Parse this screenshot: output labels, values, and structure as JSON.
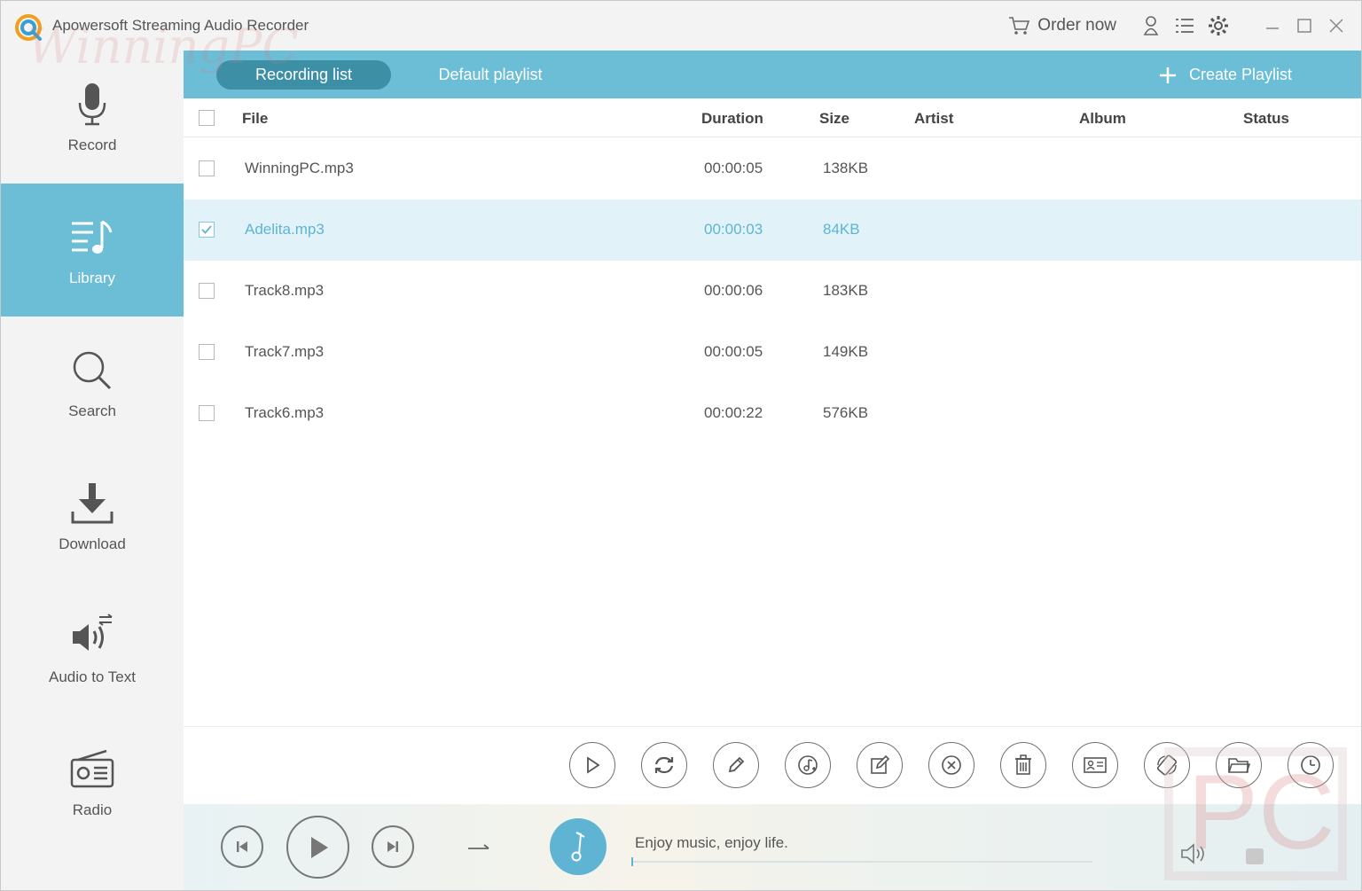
{
  "app": {
    "title": "Apowersoft Streaming Audio Recorder",
    "brand_color": "#6cbdd6",
    "accent_dark": "#3d8fa6",
    "order_label": "Order now",
    "icons": [
      "cart-icon",
      "user-icon",
      "menu-list-icon",
      "gear-icon",
      "minimize-icon",
      "maximize-icon",
      "close-icon"
    ]
  },
  "watermark": {
    "text": "WinningPC",
    "box_text": "PC"
  },
  "sidebar": {
    "items": [
      {
        "label": "Record",
        "icon": "microphone-icon",
        "active": false
      },
      {
        "label": "Library",
        "icon": "music-library-icon",
        "active": true
      },
      {
        "label": "Search",
        "icon": "search-icon",
        "active": false
      },
      {
        "label": "Download",
        "icon": "download-icon",
        "active": false
      },
      {
        "label": "Audio to Text",
        "icon": "audio-to-text-icon",
        "active": false
      },
      {
        "label": "Radio",
        "icon": "radio-icon",
        "active": false
      }
    ]
  },
  "tabs": {
    "recording_list": "Recording list",
    "default_playlist": "Default playlist",
    "create_playlist": "Create Playlist"
  },
  "table": {
    "headers": {
      "file": "File",
      "duration": "Duration",
      "size": "Size",
      "artist": "Artist",
      "album": "Album",
      "status": "Status"
    },
    "rows": [
      {
        "file": "WinningPC.mp3",
        "duration": "00:00:05",
        "size": "138KB",
        "checked": false,
        "selected": false
      },
      {
        "file": "Adelita.mp3",
        "duration": "00:00:03",
        "size": "84KB",
        "checked": true,
        "selected": true
      },
      {
        "file": "Track8.mp3",
        "duration": "00:00:06",
        "size": "183KB",
        "checked": false,
        "selected": false
      },
      {
        "file": "Track7.mp3",
        "duration": "00:00:05",
        "size": "149KB",
        "checked": false,
        "selected": false
      },
      {
        "file": "Track6.mp3",
        "duration": "00:00:22",
        "size": "576KB",
        "checked": false,
        "selected": false
      }
    ]
  },
  "toolbar": {
    "buttons": [
      "play-icon",
      "convert-icon",
      "pencil-icon",
      "music-add-icon",
      "edit-icon",
      "remove-icon",
      "trash-icon",
      "id3-tag-icon",
      "ringtone-icon",
      "folder-icon",
      "schedule-icon"
    ]
  },
  "player": {
    "now_playing_text": "Enjoy music, enjoy life.",
    "progress": 0,
    "mode_icon": "sequence-arrow-icon",
    "buttons": [
      "previous-icon",
      "play-icon",
      "next-icon"
    ]
  }
}
